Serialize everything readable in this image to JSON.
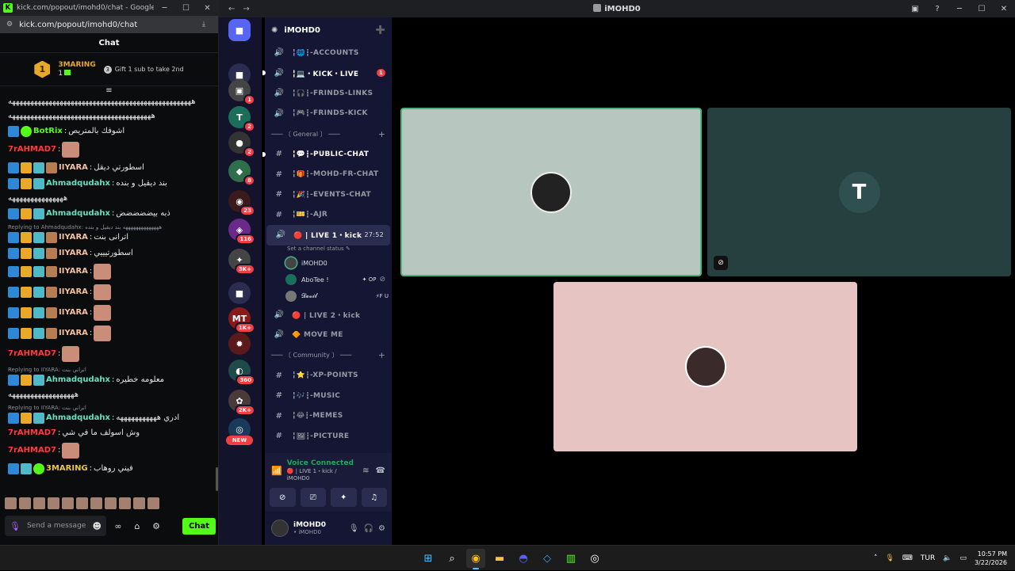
{
  "kick": {
    "window_title": "kick.com/popout/imohd0/chat - Google Chr...",
    "url": "kick.com/popout/imohd0/chat",
    "header": "Chat",
    "gifter": {
      "rank": "1",
      "name": "3MARING",
      "count": "1"
    },
    "gift_prompt": "Gift 1 sub to take 2nd",
    "colors": {
      "kick_green": "#53fc18",
      "gold": "#e8a829",
      "red_user": "#ff3b3b"
    },
    "messages": [
      {
        "type": "text",
        "badges": [],
        "user": "",
        "color": "#e6e6e6",
        "text": "ههههههههههههههههههههههههههههههههههههههههههههههههههه"
      },
      {
        "type": "text",
        "badges": [],
        "user": "",
        "color": "#e6e6e6",
        "text": "هههههههههههههههههههههههههههههههههههههههه"
      },
      {
        "type": "text",
        "badges": [
          "bt",
          "bv"
        ],
        "user": "BotRix",
        "color": "#53fc18",
        "text": "اشوفك بالمتريص"
      },
      {
        "type": "emote",
        "badges": [],
        "user": "7rAHMAD7",
        "color": "#ff3b3b",
        "text": ""
      },
      {
        "type": "text",
        "badges": [
          "bt",
          "bc",
          "bk",
          "bh"
        ],
        "user": "IIYARA",
        "color": "#f2c0a0",
        "text": "اسطورتي ديقل"
      },
      {
        "type": "text",
        "badges": [
          "bt",
          "bc",
          "bk"
        ],
        "user": "Ahmadqudahx",
        "color": "#5fe3c0",
        "text": "بند ديقيل و بنده"
      },
      {
        "type": "text",
        "badges": [],
        "user": "",
        "color": "#e6e6e6",
        "text": "هههههههههههههههه"
      },
      {
        "type": "text",
        "badges": [
          "bt",
          "bc",
          "bk"
        ],
        "user": "Ahmadqudahx",
        "color": "#5fe3c0",
        "text": "ذبه بيضضضضض"
      },
      {
        "type": "reply",
        "text": "Replying to Ahmadqudahx: ههههههههههههههه بند ديقيل و بنده"
      },
      {
        "type": "text",
        "badges": [
          "bt",
          "bc",
          "bk",
          "bh"
        ],
        "user": "IIYARA",
        "color": "#f2c0a0",
        "text": "اترانى بنت"
      },
      {
        "type": "text",
        "badges": [
          "bt",
          "bc",
          "bk",
          "bh"
        ],
        "user": "IIYARA",
        "color": "#f2c0a0",
        "text": "اسطورتيييي"
      },
      {
        "type": "emote",
        "badges": [
          "bt",
          "bc",
          "bk",
          "bh"
        ],
        "user": "IIYARA",
        "color": "#f2c0a0",
        "text": ""
      },
      {
        "type": "emote",
        "badges": [
          "bt",
          "bc",
          "bk",
          "bh"
        ],
        "user": "IIYARA",
        "color": "#f2c0a0",
        "text": ""
      },
      {
        "type": "emote",
        "badges": [
          "bt",
          "bc",
          "bk",
          "bh"
        ],
        "user": "IIYARA",
        "color": "#f2c0a0",
        "text": ""
      },
      {
        "type": "emote",
        "badges": [
          "bt",
          "bc",
          "bk",
          "bh"
        ],
        "user": "IIYARA",
        "color": "#f2c0a0",
        "text": ""
      },
      {
        "type": "emote",
        "badges": [],
        "user": "7rAHMAD7",
        "color": "#ff3b3b",
        "text": ""
      },
      {
        "type": "reply",
        "text": "Replying to IIYARA: اتراني بنت"
      },
      {
        "type": "text",
        "badges": [
          "bt",
          "bc",
          "bk"
        ],
        "user": "Ahmadqudahx",
        "color": "#5fe3c0",
        "text": "معلومه خطيره"
      },
      {
        "type": "text",
        "badges": [],
        "user": "",
        "color": "#e6e6e6",
        "text": "ههههههههههههههههههه"
      },
      {
        "type": "reply",
        "text": "Replying to IIYARA: اتراني بنت"
      },
      {
        "type": "text",
        "badges": [
          "bt",
          "bc",
          "bk"
        ],
        "user": "Ahmadqudahx",
        "color": "#5fe3c0",
        "text": "ادري هههههههههههه"
      },
      {
        "type": "text",
        "badges": [],
        "user": "7rAHMAD7",
        "color": "#ff3b3b",
        "text": "وش اسولف ما في شي"
      },
      {
        "type": "emote",
        "badges": [],
        "user": "7rAHMAD7",
        "color": "#ff3b3b",
        "text": ""
      },
      {
        "type": "text",
        "badges": [
          "bt",
          "bk",
          "bv"
        ],
        "user": "3MARING",
        "color": "#e8c83a",
        "text": "فيني روهاب"
      }
    ],
    "input_placeholder": "Send a message",
    "chat_button": "Chat"
  },
  "discord": {
    "window_title": "iMOHD0",
    "server_name": "iMOHD0",
    "guilds": [
      {
        "label": "■",
        "bg": "#5865f2",
        "badge": ""
      },
      {
        "label": "■",
        "bg": "#2b2d50",
        "badge": ""
      },
      {
        "label": "▣",
        "bg": "#444",
        "badge": "1"
      },
      {
        "label": "T",
        "bg": "#1b6e5a",
        "badge": "2"
      },
      {
        "label": "●",
        "bg": "#333",
        "badge": "2"
      },
      {
        "label": "◆",
        "bg": "#2f6e4a",
        "badge": "8"
      },
      {
        "label": "◉",
        "bg": "#3a1a1a",
        "badge": "23"
      },
      {
        "label": "◈",
        "bg": "#6a2a8a",
        "badge": "116"
      },
      {
        "label": "✦",
        "bg": "#444",
        "badge": "3K+"
      },
      {
        "label": "■",
        "bg": "#2b2d50",
        "badge": ""
      },
      {
        "label": "MT",
        "bg": "#8a1a1a",
        "badge": "1K+"
      },
      {
        "label": "✹",
        "bg": "#5a1a1a",
        "badge": ""
      },
      {
        "label": "◐",
        "bg": "#1e4a4a",
        "badge": "360"
      },
      {
        "label": "✿",
        "bg": "#4a3a3a",
        "badge": "2K+"
      },
      {
        "label": "◎",
        "bg": "#1a3a5a",
        "badge": ""
      }
    ],
    "new_label": "NEW",
    "channels_top": [
      {
        "icon": "🔊",
        "name": "╏🌐┇-ACCOUNTS",
        "unread": false,
        "badge": ""
      },
      {
        "icon": "🔊",
        "name": "╏💻・KICK・LIVE",
        "unread": true,
        "badge": "1"
      },
      {
        "icon": "🔊",
        "name": "╏🎧┇-FRINDS-LINKS",
        "unread": false,
        "badge": ""
      },
      {
        "icon": "🔊",
        "name": "╏🎮┇-FRINDS-KICK",
        "unread": false,
        "badge": ""
      }
    ],
    "category_general": "─── 〔 General 〕 ───",
    "channels_general": [
      {
        "icon": "#",
        "name": "╏💬┇-PUBLIC-CHAT",
        "unread": true,
        "badge": ""
      },
      {
        "icon": "#",
        "name": "╏🎁┇-MOHD-FR-CHAT",
        "unread": false,
        "badge": ""
      },
      {
        "icon": "#",
        "name": "╏🎉┇-EVENTS-CHAT",
        "unread": false,
        "badge": ""
      },
      {
        "icon": "#",
        "name": "╏🎫┇-AJR",
        "unread": false,
        "badge": ""
      }
    ],
    "live_channel": {
      "icon": "🔊",
      "name": "🔴 | LIVE 1・kick",
      "time": "27:52",
      "status": "Set a channel status ✎"
    },
    "voice_users": [
      {
        "name": "iMOHD0",
        "tag": "",
        "av": "#444",
        "muted": false
      },
      {
        "name": "AboTee !",
        "tag": "✦ OP",
        "av": "#1b6e5a",
        "muted": true
      },
      {
        "name": "𝓓𝓮𝓿𝓲𝓵",
        "tag": "⚡F U",
        "av": "#777",
        "muted": false
      }
    ],
    "voice_channels": [
      {
        "icon": "🔊",
        "name": "🔴 | LIVE 2・kick",
        "unread": false,
        "badge": ""
      },
      {
        "icon": "🔊",
        "name": "🔶 MOVE ME",
        "unread": false,
        "badge": ""
      }
    ],
    "category_community": "─── 〔 Community 〕 ───",
    "channels_community": [
      {
        "icon": "#",
        "name": "╏⭐┇-XP-POINTS",
        "unread": false,
        "badge": ""
      },
      {
        "icon": "#",
        "name": "╏🎶┇-MUSIC",
        "unread": false,
        "badge": ""
      },
      {
        "icon": "#",
        "name": "╏😂┇-MEMES",
        "unread": false,
        "badge": ""
      },
      {
        "icon": "#",
        "name": "╏🖼┇-PICTURE",
        "unread": false,
        "badge": ""
      }
    ],
    "voice_panel": {
      "title": "Voice Connected",
      "subtitle": "🔴 | LIVE 1・kick / iMOHD0"
    },
    "user_panel": {
      "name": "iMOHD0",
      "status": "• iMOHD0"
    },
    "colors": {
      "tile1": "#b8c6c0",
      "tile2": "#26403f",
      "tile3": "#e6c4c2",
      "speaking": "#43b581"
    }
  },
  "taskbar": {
    "lang": "TUR",
    "time": "10:57 PM",
    "date": "3/22/2026"
  }
}
